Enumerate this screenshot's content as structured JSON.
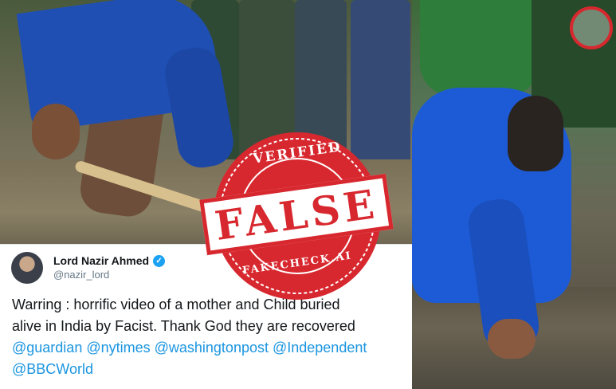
{
  "tweet": {
    "author_name": "Lord Nazir Ahmed",
    "handle": "@nazir_lord",
    "text_lines": [
      "Warring : horrific video of a mother and Child buried",
      "alive in India by Facist. Thank God they are recovered"
    ],
    "mentions_line1": "@guardian @nytimes @washingtonpost @Independent",
    "mentions_line2": "@BBCWorld"
  },
  "stamp": {
    "top_text": "VERIFIED",
    "main_text": "FALSE",
    "bottom_text": "FAKECHECK.AI",
    "color": "#d8282f"
  },
  "colors": {
    "mention": "#1b95e0",
    "verified_badge": "#1da1f2"
  }
}
